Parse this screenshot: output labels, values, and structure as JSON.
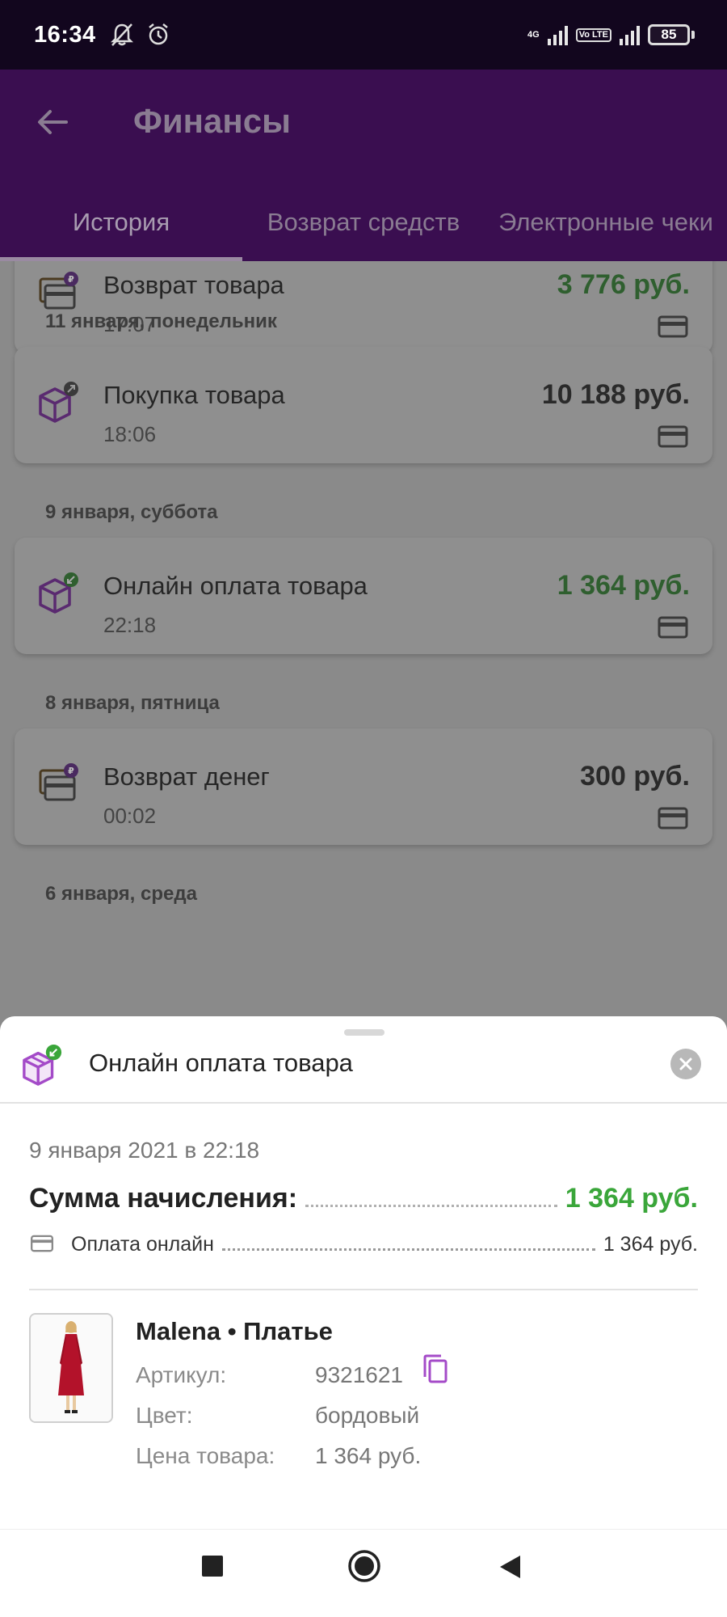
{
  "status_bar": {
    "time": "16:34",
    "network_tag": "4G",
    "volte": "Vo LTE",
    "battery": "85"
  },
  "header": {
    "title": "Финансы",
    "tabs": [
      {
        "label": "История",
        "active": true
      },
      {
        "label": "Возврат средств",
        "active": false
      },
      {
        "label": "Электронные чеки",
        "active": false
      }
    ]
  },
  "history": {
    "cards": [
      {
        "title": "Возврат товара",
        "time": "17:07",
        "amount": "3 776 руб.",
        "positive": true,
        "icon": "refund-card-icon"
      },
      {
        "title": "Покупка товара",
        "time": "18:06",
        "amount": "10 188 руб.",
        "positive": false,
        "icon": "box-out-icon"
      },
      {
        "title": "Онлайн оплата товара",
        "time": "22:18",
        "amount": "1 364 руб.",
        "positive": true,
        "icon": "box-in-icon"
      },
      {
        "title": "Возврат денег",
        "time": "00:02",
        "amount": "300 руб.",
        "positive": false,
        "icon": "refund-card-icon"
      }
    ],
    "day_headers": [
      "11 января, понедельник",
      "9 января, суббота",
      "8 января, пятница",
      "6 января, среда"
    ]
  },
  "sheet": {
    "title": "Онлайн оплата товара",
    "date": "9 января 2021 в 22:18",
    "sum_label": "Сумма начисления:",
    "sum_value": "1 364 руб.",
    "payment_label": "Оплата онлайн",
    "payment_value": "1 364 руб.",
    "product": {
      "title": "Malena • Платье",
      "article_label": "Артикул:",
      "article_value": "9321621",
      "color_label": "Цвет:",
      "color_value": "бордовый",
      "price_label": "Цена товара:",
      "price_value": "1 364 руб."
    }
  },
  "colors": {
    "brand_purple": "#5a1a78",
    "accent_green": "#3aa63a",
    "icon_purple": "#a44bc8"
  }
}
